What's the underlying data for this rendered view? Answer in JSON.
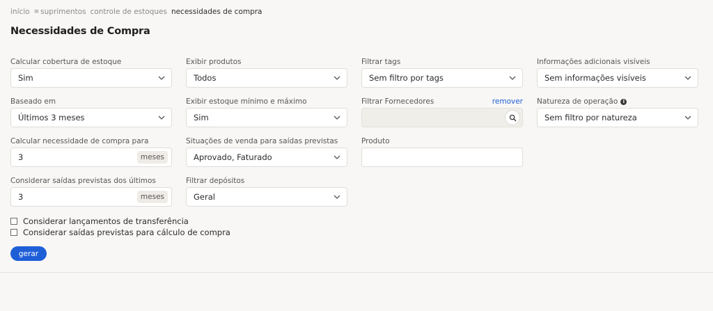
{
  "breadcrumb": {
    "home": "início",
    "menu_glyph": "≡",
    "supplies": "suprimentos",
    "stock_control": "controle de estoques",
    "current": "necessidades de compra"
  },
  "page": {
    "title": "Necessidades de Compra"
  },
  "filters": {
    "calc_coverage": {
      "label": "Calcular cobertura de estoque",
      "value": "Sim"
    },
    "show_products": {
      "label": "Exibir produtos",
      "value": "Todos"
    },
    "filter_tags": {
      "label": "Filtrar tags",
      "value": "Sem filtro por tags"
    },
    "extra_info": {
      "label": "Informações adicionais visíveis",
      "value": "Sem informações visíveis"
    },
    "based_on": {
      "label": "Baseado em",
      "value": "Últimos 3 meses"
    },
    "show_min_max": {
      "label": "Exibir estoque mínimo e máximo",
      "value": "Sim"
    },
    "filter_suppliers": {
      "label": "Filtrar Fornecedores",
      "remove_label": "remover",
      "value": ""
    },
    "operation_nature": {
      "label": "Natureza de operação",
      "value": "Sem filtro por natureza"
    },
    "calc_need_for": {
      "label": "Calcular necessidade de compra para",
      "value": "3",
      "suffix": "meses"
    },
    "sales_situations": {
      "label": "Situações de venda para saídas previstas",
      "value": "Aprovado, Faturado"
    },
    "product": {
      "label": "Produto",
      "value": ""
    },
    "consider_last": {
      "label": "Considerar saídas previstas dos últimos",
      "value": "3",
      "suffix": "meses"
    },
    "filter_warehouses": {
      "label": "Filtrar depósitos",
      "value": "Geral"
    }
  },
  "checkboxes": [
    {
      "label": "Considerar lançamentos de transferência",
      "checked": false
    },
    {
      "label": "Considerar saídas previstas para cálculo de compra",
      "checked": false
    }
  ],
  "actions": {
    "generate_label": "gerar"
  },
  "colors": {
    "accent": "#1e5fd8",
    "link": "#1f5fd6",
    "background": "#f8f7f5"
  }
}
